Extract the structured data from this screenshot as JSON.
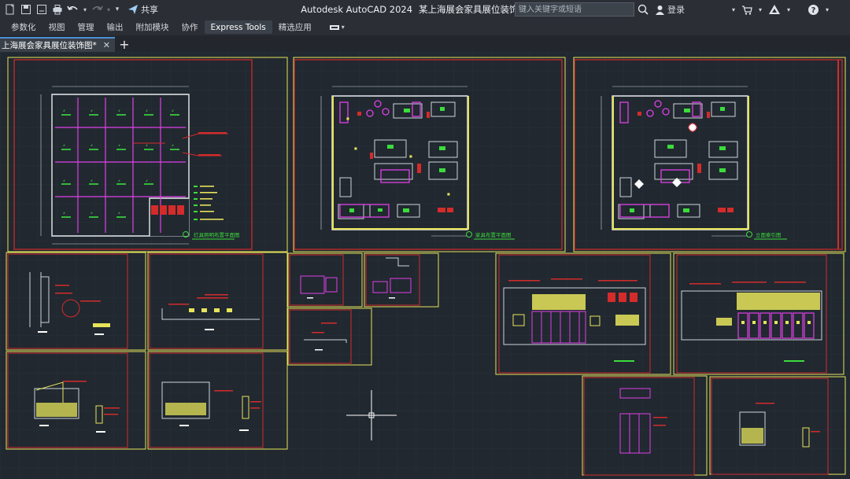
{
  "app": {
    "title": "Autodesk AutoCAD 2024",
    "file": "某上海展会家具展位装饰图.dwg"
  },
  "quick_access": {
    "share_label": "共享"
  },
  "search": {
    "placeholder": "键入关键字或短语"
  },
  "account": {
    "login_label": "登录"
  },
  "ribbon": {
    "tabs": [
      {
        "label": "参数化"
      },
      {
        "label": "视图"
      },
      {
        "label": "管理"
      },
      {
        "label": "输出"
      },
      {
        "label": "附加模块"
      },
      {
        "label": "协作"
      },
      {
        "label": "Express Tools",
        "active": true
      },
      {
        "label": "精选应用"
      }
    ]
  },
  "doc_tabs": {
    "active_label": "上海展会家具展位装饰图*"
  },
  "drawing": {
    "sheet_titles": [
      "灯具照明布置平面图",
      "家具布置平面图",
      "立面索引图"
    ]
  },
  "colors": {
    "canvas": "#212830",
    "frame_red": "#d42b2b",
    "frame_yellow": "#e6e45a",
    "magenta": "#e040e8",
    "green": "#3cdc3c",
    "cyan": "#40d8e0",
    "grid_gray": "#2e3640"
  }
}
